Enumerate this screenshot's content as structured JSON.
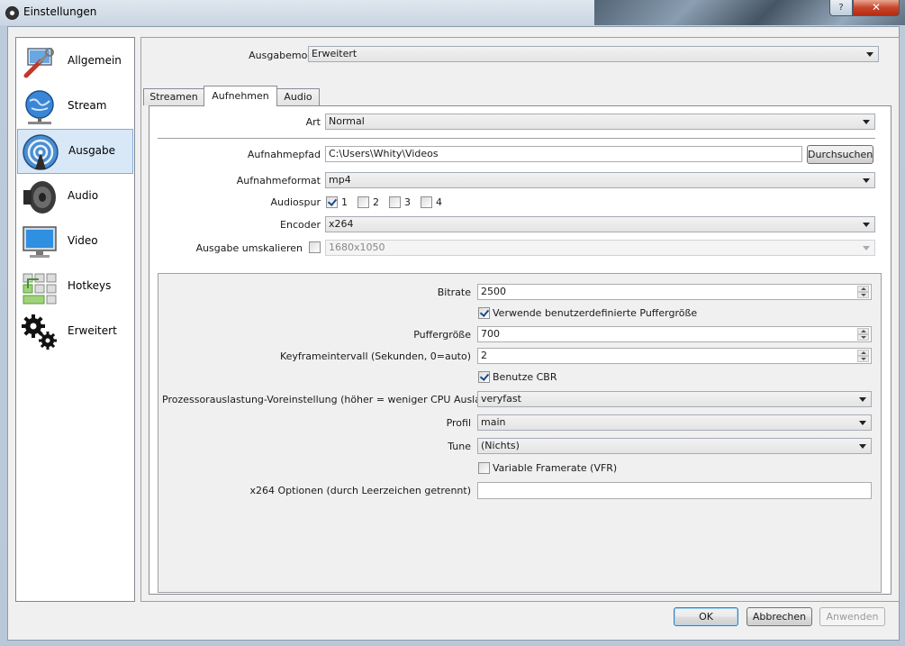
{
  "window": {
    "title": "Einstellungen",
    "help_label": "?",
    "close_label": "✕"
  },
  "sidebar": {
    "items": [
      {
        "label": "Allgemein",
        "icon": "wrench-screwdriver-icon"
      },
      {
        "label": "Stream",
        "icon": "globe-network-icon"
      },
      {
        "label": "Ausgabe",
        "icon": "broadcast-antenna-icon"
      },
      {
        "label": "Audio",
        "icon": "speaker-icon"
      },
      {
        "label": "Video",
        "icon": "monitor-icon"
      },
      {
        "label": "Hotkeys",
        "icon": "keyboard-icon"
      },
      {
        "label": "Erweitert",
        "icon": "gears-icon"
      }
    ],
    "active": "Ausgabe"
  },
  "output_mode": {
    "label": "Ausgabemodus",
    "value": "Erweitert"
  },
  "tabs": [
    {
      "label": "Streamen"
    },
    {
      "label": "Aufnehmen"
    },
    {
      "label": "Audio"
    }
  ],
  "recording": {
    "type_label": "Art",
    "type_value": "Normal",
    "path_label": "Aufnahmepfad",
    "path_value": "C:\\Users\\Whity\\Videos",
    "browse_label": "Durchsuchen",
    "format_label": "Aufnahmeformat",
    "format_value": "mp4",
    "audiotrack_label": "Audiospur",
    "tracks": [
      {
        "label": "1",
        "checked": true
      },
      {
        "label": "2",
        "checked": false
      },
      {
        "label": "3",
        "checked": false
      },
      {
        "label": "4",
        "checked": false
      }
    ],
    "encoder_label": "Encoder",
    "encoder_value": "x264",
    "rescale_label": "Ausgabe umskalieren",
    "rescale_value": "1680x1050"
  },
  "encoder_settings": {
    "bitrate_label": "Bitrate",
    "bitrate_value": "2500",
    "custom_buffer_label": "Verwende benutzerdefinierte Puffergröße",
    "buffer_label": "Puffergröße",
    "buffer_value": "700",
    "keyframe_label": "Keyframeintervall (Sekunden, 0=auto)",
    "keyframe_value": "2",
    "cbr_label": "Benutze CBR",
    "preset_label": "Prozessorauslastung-Voreinstellung (höher = weniger CPU Auslastung)",
    "preset_value": "veryfast",
    "profile_label": "Profil",
    "profile_value": "main",
    "tune_label": "Tune",
    "tune_value": "(Nichts)",
    "vfr_label": "Variable Framerate (VFR)",
    "x264opts_label": "x264 Optionen (durch Leerzeichen getrennt)",
    "x264opts_value": ""
  },
  "footer": {
    "ok_label": "OK",
    "cancel_label": "Abbrechen",
    "apply_label": "Anwenden"
  }
}
